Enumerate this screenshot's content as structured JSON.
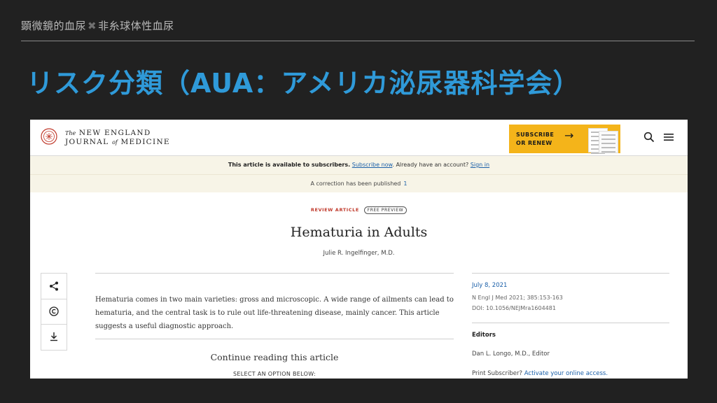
{
  "slide": {
    "breadcrumb_a": "顕微鏡的血尿",
    "breadcrumb_sep": "✖",
    "breadcrumb_b": "非糸球体性血尿",
    "title": "リスク分類（AUA：アメリカ泌尿器科学会）"
  },
  "colors": {
    "title": "#2f9ad9",
    "subscribe_bg": "#f4b41a",
    "link": "#1a5fa8",
    "kicker": "#c0392b"
  },
  "header": {
    "logo_line1_small": "The",
    "logo_line1": "NEW ENGLAND",
    "logo_line2a": "JOURNAL",
    "logo_line2_small": "of",
    "logo_line2b": "MEDICINE",
    "subscribe_label": "SUBSCRIBE\nOR RENEW",
    "subscribe_arrow": "→",
    "icons": [
      "seal-icon",
      "search-icon",
      "menu-icon"
    ]
  },
  "notice": {
    "subscribers_text": "This article is available to subscribers.",
    "subscribe_link": "Subscribe now",
    "already_text": "Already have an account?",
    "signin_link": "Sign in",
    "correction_text": "A correction has been published",
    "correction_count": "1"
  },
  "article": {
    "type": "REVIEW ARTICLE",
    "badge": "FREE PREVIEW",
    "title": "Hematuria in Adults",
    "author": "Julie R. Ingelfinger, M.D.",
    "abstract": "Hematuria comes in two main varieties: gross and microscopic. A wide range of ailments can lead to hematuria, and the central task is to rule out life-threatening disease, mainly cancer. This article suggests a useful diagnostic approach.",
    "continue": "Continue reading this article",
    "select_option": "SELECT AN OPTION BELOW:"
  },
  "tools": [
    "share-icon",
    "copyright-icon",
    "download-icon"
  ],
  "sidebar": {
    "date": "July 8, 2021",
    "citation": "N Engl J Med 2021; 385:153-163",
    "doi": "DOI: 10.1056/NEJMra1604481",
    "editors_heading": "Editors",
    "editor": "Dan L. Longo, M.D., Editor",
    "print_text": "Print Subscriber?",
    "print_link": "Activate your online access."
  }
}
